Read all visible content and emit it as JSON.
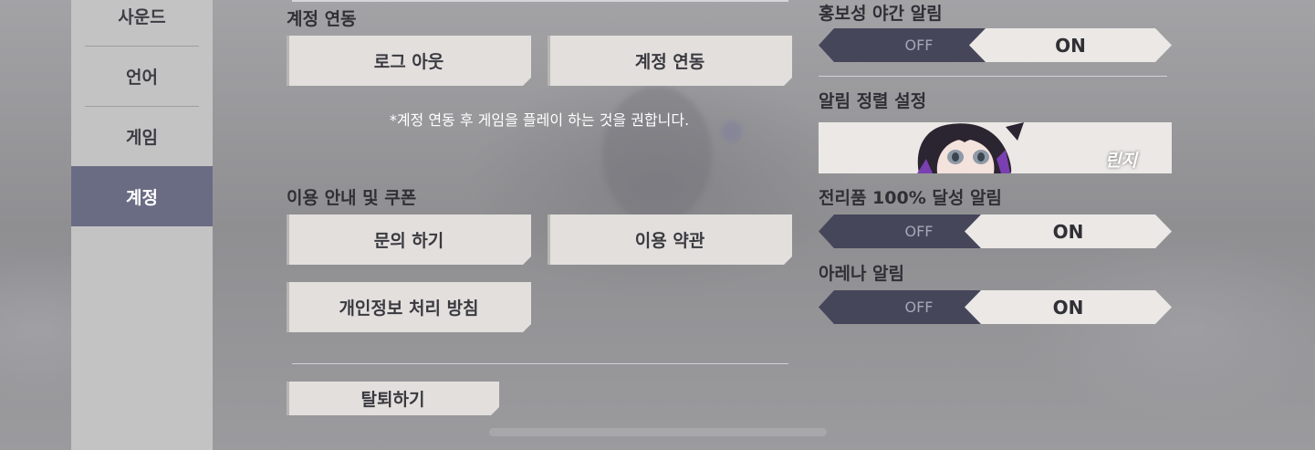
{
  "sidebar": {
    "items": [
      {
        "label": "사운드"
      },
      {
        "label": "언어"
      },
      {
        "label": "게임"
      },
      {
        "label": "계정"
      }
    ],
    "active": "계정"
  },
  "account": {
    "title": "계정 연동",
    "logout_label": "로그 아웃",
    "link_label": "계정 연동",
    "note": "*계정 연동 후 게임을 플레이 하는 것을 권합니다."
  },
  "info": {
    "title": "이용 안내 및 쿠폰",
    "inquiry_label": "문의 하기",
    "terms_label": "이용 약관",
    "privacy_label": "개인정보 처리 방침"
  },
  "withdraw_label": "탈퇴하기",
  "notifications": {
    "night_promo": {
      "title": "홍보성 야간 알림",
      "off": "OFF",
      "on": "ON",
      "value": "ON"
    },
    "sort": {
      "title": "알림 정렬 설정",
      "character_name": "린지"
    },
    "trophy": {
      "title": "전리품 100% 달성 알림",
      "off": "OFF",
      "on": "ON",
      "value": "ON"
    },
    "arena": {
      "title": "아레나 알림",
      "off": "OFF",
      "on": "ON",
      "value": "ON"
    }
  },
  "colors": {
    "sidebar_active": "#6a6c84",
    "toggle_off_bg": "#45465a",
    "toggle_on_bg": "#ebe8e6",
    "button_bg": "#e2dfdd"
  }
}
